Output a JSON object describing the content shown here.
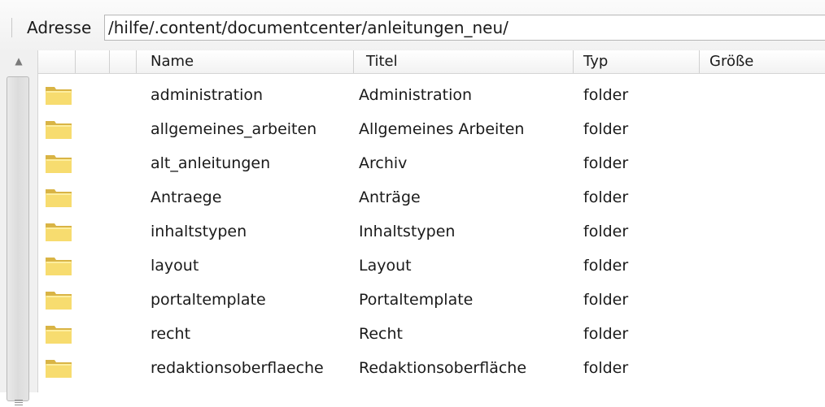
{
  "address": {
    "label": "Adresse",
    "value": "/hilfe/.content/documentcenter/anleitungen_neu/"
  },
  "columns": {
    "name": "Name",
    "title": "Titel",
    "type": "Typ",
    "size": "Größe"
  },
  "rows": [
    {
      "name": "administration",
      "title": "Administration",
      "type": "folder",
      "icon": "folder-icon"
    },
    {
      "name": "allgemeines_arbeiten",
      "title": "Allgemeines Arbeiten",
      "type": "folder",
      "icon": "folder-icon"
    },
    {
      "name": "alt_anleitungen",
      "title": "Archiv",
      "type": "folder",
      "icon": "folder-icon"
    },
    {
      "name": "Antraege",
      "title": "Anträge",
      "type": "folder",
      "icon": "folder-icon"
    },
    {
      "name": "inhaltstypen",
      "title": "Inhaltstypen",
      "type": "folder",
      "icon": "folder-icon"
    },
    {
      "name": "layout",
      "title": "Layout",
      "type": "folder",
      "icon": "folder-icon"
    },
    {
      "name": "portaltemplate",
      "title": "Portaltemplate",
      "type": "folder",
      "icon": "folder-icon"
    },
    {
      "name": "recht",
      "title": "Recht",
      "type": "folder",
      "icon": "folder-icon"
    },
    {
      "name": "redaktionsoberflaeche",
      "title": "Redaktionsoberfläche",
      "type": "folder",
      "icon": "folder-icon"
    }
  ],
  "colors": {
    "folder_fill": "#f7dc6f",
    "folder_edge": "#d9b445"
  }
}
